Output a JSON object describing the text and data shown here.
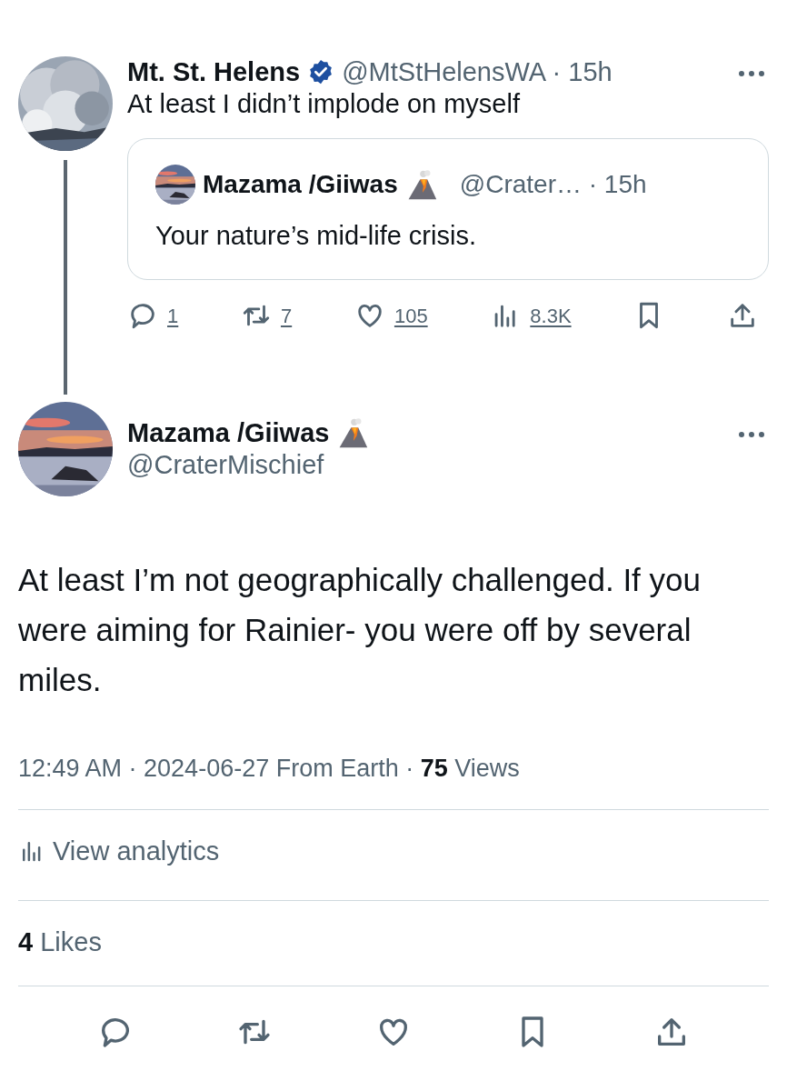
{
  "tweet": {
    "author": "Mt. St. Helens",
    "verified": true,
    "byline": "@MtStHelensWA · 15h",
    "text": "At least I didn’t implode on myself",
    "quote": {
      "author": "Mazama /Giiwas",
      "byline": "@Crater… · 15h",
      "text": "Your nature’s mid-life crisis."
    },
    "actions": [
      {
        "kind": "reply",
        "count": "1"
      },
      {
        "kind": "repost",
        "count": "7"
      },
      {
        "kind": "like",
        "count": "105"
      },
      {
        "kind": "views",
        "count": "8.3K"
      },
      {
        "kind": "bookmark"
      },
      {
        "kind": "share"
      }
    ]
  },
  "reply": {
    "author": "Mazama /Giiwas",
    "handle": "@CraterMischief",
    "text": "At least I’m not geographically challenged. If you were aiming for Rainier- you were off by several miles.",
    "timestamp": "12:49 AM · 2024-06-27 From Earth · **75** Views",
    "analytics": "View analytics",
    "likes": "**4** Likes",
    "actions": [
      {
        "kind": "reply"
      },
      {
        "kind": "repost"
      },
      {
        "kind": "like"
      },
      {
        "kind": "bookmark"
      },
      {
        "kind": "share"
      }
    ]
  }
}
